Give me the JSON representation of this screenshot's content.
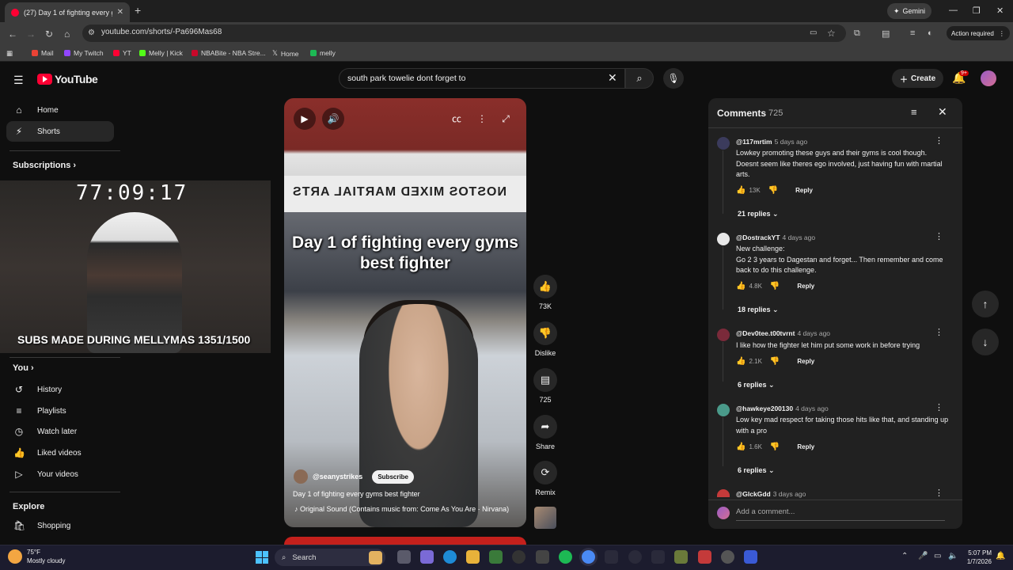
{
  "browser": {
    "tab_title": "(27) Day 1 of fighting every gym...",
    "gemini_label": "Gemini",
    "url": "youtube.com/shorts/-Pa696Mas68",
    "action_required": "Action required",
    "bookmarks": [
      {
        "label": "Mail",
        "color": "#ea4335"
      },
      {
        "label": "My Twitch",
        "color": "#9146ff"
      },
      {
        "label": "YT",
        "color": "#ff0033"
      },
      {
        "label": "Melly | Kick",
        "color": "#53fc18"
      },
      {
        "label": "NBABite - NBA Stre...",
        "color": "#c9082a"
      },
      {
        "label": "Home",
        "color": "#ffffff"
      },
      {
        "label": "melly",
        "color": "#1db954"
      }
    ]
  },
  "youtube": {
    "logo_text": "YouTube",
    "search_query": "south park towelie dont forget to",
    "create_label": "Create",
    "notif_count": "9+"
  },
  "sidebar": {
    "main": [
      {
        "label": "Home",
        "icon": "home-icon"
      },
      {
        "label": "Shorts",
        "icon": "shorts-icon"
      }
    ],
    "subscriptions_heading": "Subscriptions",
    "you_heading": "You",
    "you_items": [
      {
        "label": "History",
        "icon": "history-icon"
      },
      {
        "label": "Playlists",
        "icon": "playlists-icon"
      },
      {
        "label": "Watch later",
        "icon": "watch-later-icon"
      },
      {
        "label": "Liked videos",
        "icon": "like-icon"
      },
      {
        "label": "Your videos",
        "icon": "your-videos-icon"
      }
    ],
    "explore_heading": "Explore",
    "explore_items": [
      {
        "label": "Shopping",
        "icon": "shopping-icon"
      }
    ]
  },
  "overlay": {
    "timer": "77:09:17",
    "subs_banner": "SUBS MADE DURING MELLYMAS 1351/1500"
  },
  "video": {
    "sign_text": "NOSTOS MIXED MARTIAL ARTS",
    "overlay_title": "Day 1 of fighting every gyms best fighter",
    "channel": "@seanystrikes",
    "subscribe": "Subscribe",
    "description": "Day 1 of fighting every gyms best fighter",
    "sound": "Original Sound (Contains music from: Come As You Are · Nirvana)"
  },
  "actions": {
    "likes": "73K",
    "dislike": "Dislike",
    "comments": "725",
    "share": "Share",
    "remix": "Remix"
  },
  "comments": {
    "title": "Comments",
    "count": "725",
    "add_placeholder": "Add a comment...",
    "items": [
      {
        "user": "@117mrtim",
        "ago": "5 days ago",
        "text": "Lowkey promoting these guys and their gyms is cool though. Doesnt seem like theres ego involved, just having fun with martial arts.",
        "likes": "13K",
        "replies": "21 replies",
        "avatar_color": "#3b3b5c"
      },
      {
        "user": "@DostrackYT",
        "ago": "4 days ago",
        "text": "New challenge:\nGo 2 3 years to Dagestan and forget... Then remember and come back to do this challenge.",
        "likes": "4.8K",
        "replies": "18 replies",
        "avatar_color": "#e8e8e8"
      },
      {
        "user": "@Dev0tee.t00tvrnt",
        "ago": "4 days ago",
        "text": "I like how the fighter let him put some work in before trying",
        "likes": "2.1K",
        "replies": "6 replies",
        "avatar_color": "#7a2a3a"
      },
      {
        "user": "@hawkeye200130",
        "ago": "4 days ago",
        "text": "Low key mad respect for taking those hits like that, and standing up with a pro",
        "likes": "1.6K",
        "replies": "6 replies",
        "avatar_color": "#4a9a8a"
      },
      {
        "user": "@GlckGdd",
        "ago": "3 days ago",
        "text": "",
        "likes": "",
        "replies": "",
        "avatar_color": "#c43a3a"
      }
    ],
    "reply_label": "Reply"
  },
  "taskbar": {
    "temp": "75°F",
    "weather": "Mostly cloudy",
    "search_label": "Search",
    "time": "5:07 PM",
    "date": "1/7/2026"
  }
}
